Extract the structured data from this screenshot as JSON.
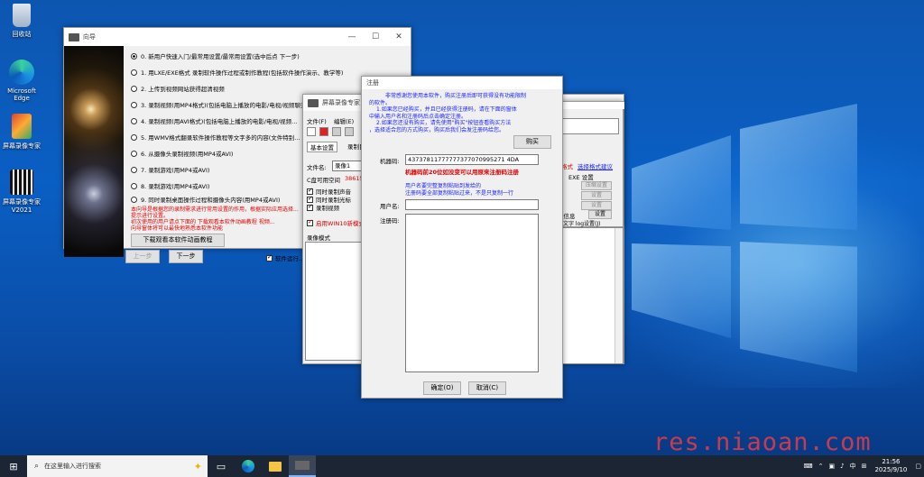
{
  "desktop": {
    "icons": [
      {
        "label": "回收站"
      },
      {
        "label": "Microsoft\nEdge"
      },
      {
        "label": "屏幕录像专家"
      },
      {
        "label": "屏幕录像专家\nV2021"
      }
    ],
    "watermark": "res.niaoan.com"
  },
  "wizard": {
    "title": "向导",
    "options": [
      "0. 新用户快速入门/最常用设置/最常用设置(选中后点 下一步)",
      "1. 用LXE/EXE格式 录制软件操作过程或制作教程(包括软件操作演示、教学等)",
      "2. 上传到视频网站获得超清视频",
      "3. 录制视频(用MP4格式)(包括电脑上播放的电影/电视/视频聊天窗口/视频教学...",
      "4. 录制视频(用AVI格式)(包括电脑上播放的电影/电视/视频...",
      "5. 用WMV格式翻录软件操作教程等文字多的内容(文件特别...",
      "6. 从摄像头录制视频(用MP4或AVI)",
      "7. 录制游戏(用MP4或AVI)",
      "8. 录制游戏(用MP4或AVI)",
      "9. 同时录制桌面操作过程和摄像头内容(用MP4或AVI)"
    ],
    "hint1": "本向导是根据您的录制需求进行常用设置的作用，根据实际应用选择...",
    "hint1b": "提示进行设置。",
    "hint2": "初次使用的用户请点下面的 下载观看本软件动画教程 视频...",
    "hint2b": "向导窗体将可以最快地熟悉本软件功能",
    "tutorial_btn": "下载观看本软件动画教程",
    "prev_btn": "上一步",
    "next_btn": "下一步",
    "autorun_label": "软件运行..."
  },
  "main": {
    "title": "屏幕录像专家 V...",
    "menu": [
      "文件(F)",
      "编辑(E)"
    ],
    "tabs": [
      "基本设置",
      "录制目标"
    ],
    "filename_label": "文件名:",
    "filename_value": "录像1",
    "disk_label": "C盘可用空间",
    "disk_value": "38615",
    "checks": [
      "同时录制声音",
      "同时录制光标",
      "录制视频"
    ],
    "win10_label": "启用WIN10新模式",
    "mode_label": "录像模式",
    "right_link1": "格式",
    "right_link2": "选择格式建议",
    "right_rows": [
      "EXE  设置",
      "压缩设置",
      "设置",
      "设置"
    ],
    "right_bottom": [
      "设信息",
      "设置"
    ],
    "right_last": "叔文字 log设置(J)"
  },
  "register": {
    "title": "注册",
    "msg_line1": "非常感谢您使用本软件，购买注册后即可获得没有功能限制",
    "msg_line2": "的软件。",
    "msg_line3": "1.如果您已经购买，并且已经获得注册码，请在下面的窗体",
    "msg_line4": "中输入用户名和注册码后点击确定注册。",
    "msg_line5": "2.如果您还没有购买，请先使用\"购买\"按钮查看购买方法",
    "msg_line6": "，选择适合您的方式购买，购买后我们会发注册码给您。",
    "buy_btn": "购买",
    "machine_label": "机器码:",
    "machine_code": "43737811777777377070995271 4DA",
    "warn": "机器码前20位如没变可以用原来注册码注册",
    "info1": "用户名要完整复制粘贴到发给的",
    "info2": "注册码要全部复制粘贴过来，不是只复制一行",
    "user_label": "用户名:",
    "code_label": "注册码:",
    "ok_btn": "确定(O)",
    "cancel_btn": "取消(C)"
  },
  "taskbar": {
    "search_placeholder": "在这里输入进行搜索",
    "time": "21:56",
    "date": "2025/9/10",
    "ime": "中"
  }
}
